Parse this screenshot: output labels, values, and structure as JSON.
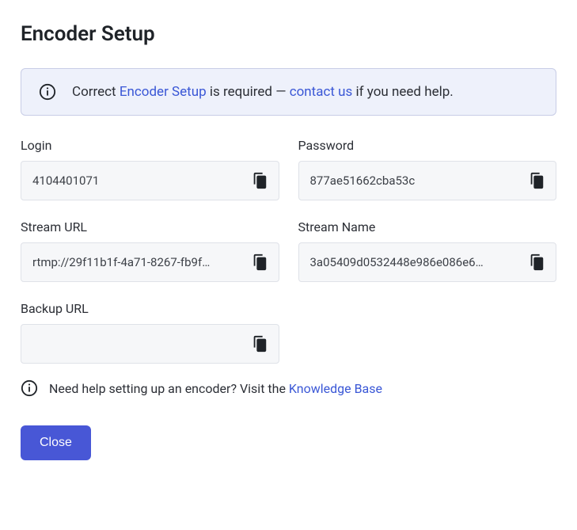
{
  "title": "Encoder Setup",
  "alert": {
    "prefix": "Correct ",
    "link1": "Encoder Setup",
    "mid": " is required — ",
    "link2": "contact us",
    "suffix": " if you need help."
  },
  "fields": {
    "login": {
      "label": "Login",
      "value": "4104401071"
    },
    "password": {
      "label": "Password",
      "value": "877ae51662cba53c"
    },
    "stream_url": {
      "label": "Stream URL",
      "value": "rtmp://29f11b1f-4a71-8267-fb9f…"
    },
    "stream_name": {
      "label": "Stream Name",
      "value": "3a05409d0532448e986e086e6…"
    },
    "backup_url": {
      "label": "Backup URL",
      "value": ""
    }
  },
  "help": {
    "prefix": "Need help setting up an encoder? Visit the ",
    "link": "Knowledge Base"
  },
  "buttons": {
    "close": "Close"
  }
}
